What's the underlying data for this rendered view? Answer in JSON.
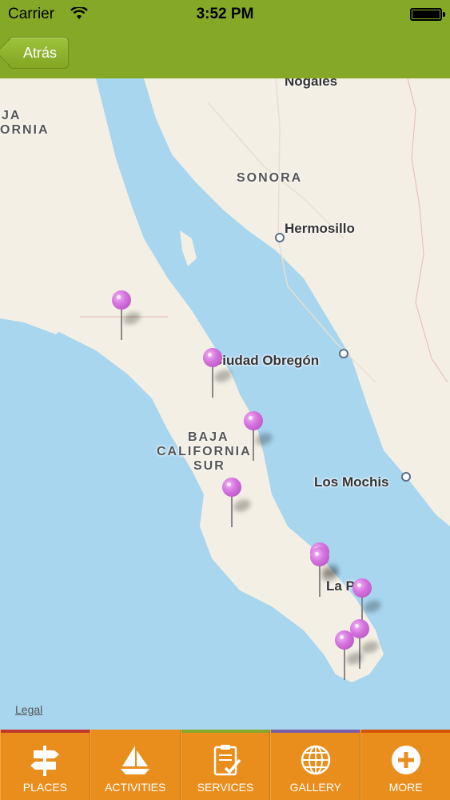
{
  "status": {
    "carrier": "Carrier",
    "time": "3:52 PM"
  },
  "nav": {
    "back_label": "Atrás"
  },
  "map": {
    "labels": {
      "ja_top": "JA",
      "fornia": "ORNIA",
      "nogales": "Nogales",
      "sonora": "SONORA",
      "hermosillo": "Hermosillo",
      "ciudad_obregon": "Ciudad Obregón",
      "baja1": "BAJA",
      "baja2": "CALIFORNIA",
      "baja3": "SUR",
      "los_mochis": "Los Mochis",
      "la_paz": "La Paz"
    },
    "legal": "Legal",
    "pin_color": "#d674e0"
  },
  "tabs": [
    {
      "label": "PLACES",
      "icon": "signpost-icon"
    },
    {
      "label": "ACTIVITIES",
      "icon": "sailboat-icon"
    },
    {
      "label": "SERVICES",
      "icon": "clipboard-check-icon"
    },
    {
      "label": "GALLERY",
      "icon": "globe-icon"
    },
    {
      "label": "MORE",
      "icon": "plus-circle-icon"
    }
  ],
  "colors": {
    "nav": "#86a827",
    "tabbar": "#e98e1c",
    "water": "#a8d6ef",
    "land": "#f3efe4"
  }
}
